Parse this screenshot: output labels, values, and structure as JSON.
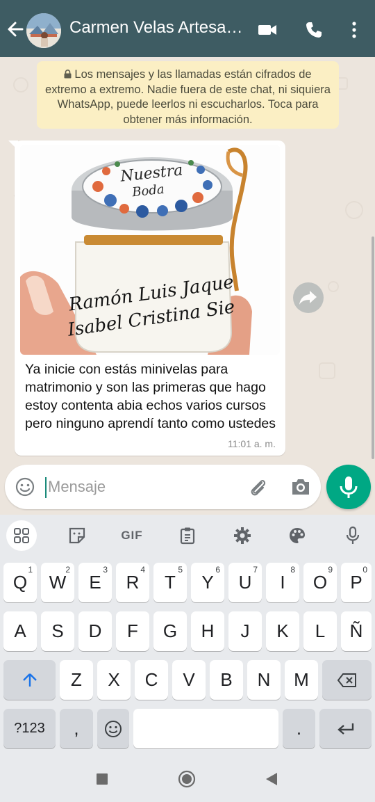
{
  "header": {
    "title": "Carmen Velas Artesa…",
    "icons": [
      "back-arrow-icon",
      "video-call-icon",
      "phone-icon",
      "more-options-icon"
    ]
  },
  "encryption_notice": {
    "text": "Los mensajes y las llamadas están cifrados de extremo a extremo. Nadie fuera de este chat, ni siquiera WhatsApp, puede leerlos ni escucharlos. Toca para obtener más información."
  },
  "message": {
    "photo_text_lid_line1": "Nuestra",
    "photo_text_lid_line2": "Boda",
    "photo_text_label_line1": "Ramón Luis Jaque",
    "photo_text_label_line2": "Isabel Cristina Sie",
    "text": "Ya inicie con estás minivelas para matrimonio y son las primeras que hago estoy contenta abia echos varios cursos pero ninguno aprendí tanto como ustedes",
    "time": "11:01 a. m."
  },
  "composer": {
    "placeholder": "Mensaje"
  },
  "keyboard": {
    "toolbar": [
      "apps-grid-icon",
      "sticker-icon",
      "GIF",
      "clipboard-icon",
      "settings-gear-icon",
      "palette-icon",
      "mic-icon"
    ],
    "gif_label": "GIF",
    "row1": [
      {
        "k": "Q",
        "n": "1"
      },
      {
        "k": "W",
        "n": "2"
      },
      {
        "k": "E",
        "n": "3"
      },
      {
        "k": "R",
        "n": "4"
      },
      {
        "k": "T",
        "n": "5"
      },
      {
        "k": "Y",
        "n": "6"
      },
      {
        "k": "U",
        "n": "7"
      },
      {
        "k": "I",
        "n": "8"
      },
      {
        "k": "O",
        "n": "9"
      },
      {
        "k": "P",
        "n": "0"
      }
    ],
    "row2": [
      "A",
      "S",
      "D",
      "F",
      "G",
      "H",
      "J",
      "K",
      "L",
      "Ñ"
    ],
    "row3": [
      "Z",
      "X",
      "C",
      "V",
      "B",
      "N",
      "M"
    ],
    "row4": {
      "symbols": "?123",
      "comma": ",",
      "period": "."
    }
  },
  "colors": {
    "header": "#3e5c63",
    "accent": "#00a884",
    "notice": "#fbefc4",
    "chat_bg": "#ece5dd"
  }
}
